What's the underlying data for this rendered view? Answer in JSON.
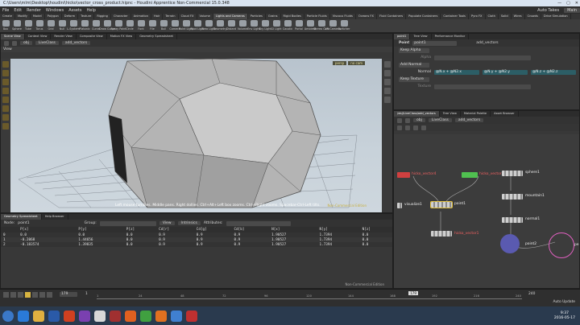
{
  "window": {
    "title": "C:\\Users\\mlm\\Desktop\\houdini\\hicko\\vector_cross_product.hipnc - Houdini Apprentice Non-Commercial 15.0.348"
  },
  "menu": [
    "File",
    "Edit",
    "Render",
    "Windows",
    "Assets",
    "Help"
  ],
  "desktop": {
    "label": "Main",
    "auto": "Auto Takes"
  },
  "shelf_tabs": [
    "Create",
    "Modify",
    "Model",
    "Polygon",
    "Deform",
    "Texture",
    "Rigging",
    "Character",
    "Animation",
    "Hair",
    "Terrain",
    "Cloud FX",
    "Volume",
    "Lights and Cameras",
    "Particles",
    "Grains",
    "Rigid Bodies",
    "Particle Fluids",
    "Viscous Fluids",
    "Oceans FX",
    "Fluid Containers",
    "Populate Containers",
    "Container Tools",
    "Pyro FX",
    "Cloth",
    "Solid",
    "Wires",
    "Crowds",
    "Drive Simulation"
  ],
  "shelf_tools": [
    "Box",
    "Sphere",
    "Tube",
    "Torus",
    "Grid",
    "Null",
    "L-System",
    "Platonic",
    "Curve",
    "Draw Curve",
    "Spray Paint",
    "Circle",
    "Font",
    "File",
    "Bull",
    "Camera",
    "Point Light",
    "Spot Light",
    "Area Light",
    "Geometry",
    "Distant",
    "Volume",
    "Env Light",
    "Sky Light",
    "GI Light",
    "Caustic",
    "Portal",
    "Ambient",
    "Stereo Cam",
    "VR Camera",
    "Switcher"
  ],
  "view_pane": {
    "tabs": [
      "Scene View",
      "Context View",
      "Render View",
      "Composite View",
      "Motion FX View",
      "Geometry Spreadsheet"
    ],
    "path": [
      "obj",
      "LiveClass",
      "add_vectors"
    ],
    "label": "View",
    "persp": "persp",
    "cam": "no cam",
    "status": "Left mouse tumbles. Middle pans. Right dollies. Ctrl+Alt+Left box zooms. Ctrl+Right zooms. Spacebar-Ctrl-Left tilts.",
    "watermark": "Non-Commercial Edition"
  },
  "spreadsheet": {
    "tabs": [
      "Geometry Spreadsheet",
      "Help Browser"
    ],
    "node_label": "Node:",
    "node": "point1",
    "group": "Group:",
    "view": "View",
    "intrinsics": "Intrinsics",
    "attributes": "Attributes:",
    "columns": [
      "",
      "P[x]",
      "P[y]",
      "P[z]",
      "Cd[r]",
      "Cd[g]",
      "Cd[b]",
      "N[x]",
      "N[y]",
      "N[z]"
    ],
    "rows": [
      [
        "0",
        "0.0",
        "0.0",
        "0.0",
        "0.9",
        "0.9",
        "0.9",
        "1.90527",
        "1.7394",
        "0.0"
      ],
      [
        "1",
        "-0.2068",
        "1.44656",
        "0.0",
        "0.9",
        "0.9",
        "0.9",
        "1.90527",
        "1.7394",
        "0.0"
      ],
      [
        "2",
        "-0.183574",
        "1.39835",
        "0.0",
        "0.9",
        "0.9",
        "0.9",
        "1.90527",
        "1.7394",
        "0.0"
      ]
    ],
    "watermark": "Non-Commercial Edition"
  },
  "params": {
    "tabs": [
      "point1",
      "Tree View",
      "Performance Monitor"
    ],
    "node_type": "Point",
    "node_name": "point1",
    "node_value": "add_vectors",
    "keep_alpha": "Keep Alpha",
    "alpha": "Alpha",
    "keep_normal": "Add Normal",
    "normal": "Normal",
    "normal_values": [
      "@N.x + @N2.x",
      "@N.y + @N2.y",
      "@N.z + @N2.z"
    ],
    "keep_texture": "Keep Texture",
    "texture": "Texture"
  },
  "network": {
    "tabs": [
      "/obj/LiveClass/add_vectors",
      "Tree View",
      "Material Palette",
      "Asset Browser"
    ],
    "path": [
      "obj",
      "LiveClass",
      "add_vectors"
    ],
    "nodes": [
      "hicko_vector4",
      "hicko_vector3",
      "sphere1",
      "mountain1",
      "normal1",
      "visualize1",
      "point1",
      "hicko_vector1",
      "point2",
      "pe"
    ]
  },
  "timeline": {
    "start": "1",
    "end": "240",
    "current": "179",
    "frame_field": "179",
    "tick_labels": [
      "1",
      "24",
      "48",
      "72",
      "96",
      "120",
      "144",
      "168",
      "192",
      "216",
      "240"
    ],
    "auto_update": "Auto Update"
  },
  "taskbar": {
    "time": "9:37",
    "date": "2016-05-17"
  }
}
